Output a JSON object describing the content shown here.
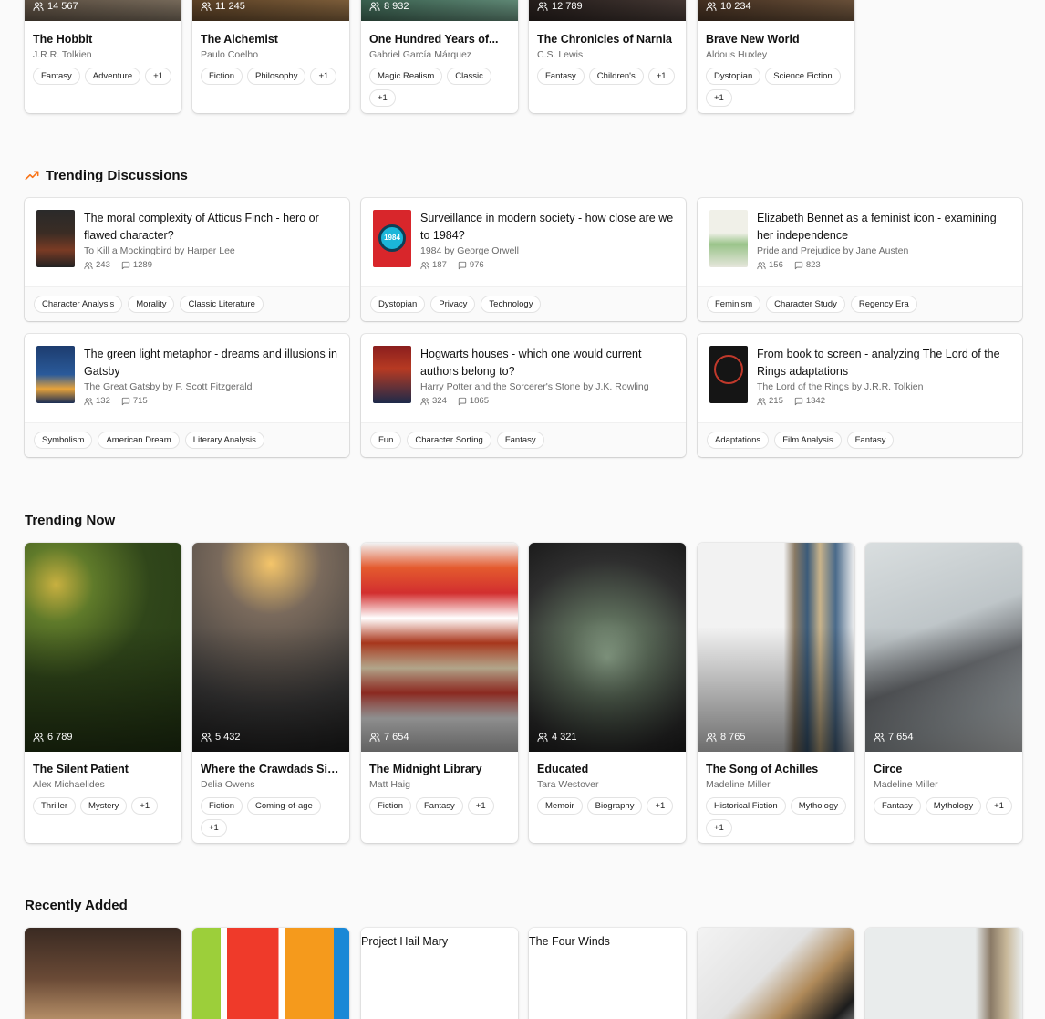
{
  "top_books": [
    {
      "title": "The Hobbit",
      "author": "J.R.R. Tolkien",
      "readers": "14 567",
      "tags": [
        "Fantasy",
        "Adventure",
        "+1"
      ]
    },
    {
      "title": "The Alchemist",
      "author": "Paulo Coelho",
      "readers": "11 245",
      "tags": [
        "Fiction",
        "Philosophy",
        "+1"
      ]
    },
    {
      "title": "One Hundred Years of...",
      "author": "Gabriel García Márquez",
      "readers": "8 932",
      "tags": [
        "Magic Realism",
        "Classic",
        "+1"
      ]
    },
    {
      "title": "The Chronicles of Narnia",
      "author": "C.S. Lewis",
      "readers": "12 789",
      "tags": [
        "Fantasy",
        "Children's",
        "+1"
      ]
    },
    {
      "title": "Brave New World",
      "author": "Aldous Huxley",
      "readers": "10 234",
      "tags": [
        "Dystopian",
        "Science Fiction",
        "+1"
      ]
    }
  ],
  "discussions_heading": "Trending Discussions",
  "discussions": [
    {
      "title": "The moral complexity of Atticus Finch - hero or flawed character?",
      "book": "To Kill a Mockingbird by Harper Lee",
      "members": "243",
      "comments": "1289",
      "tags": [
        "Character Analysis",
        "Morality",
        "Classic Literature"
      ],
      "cover_text": "To Kill a Mockingbird"
    },
    {
      "title": "Surveillance in modern society - how close are we to 1984?",
      "book": "1984 by George Orwell",
      "members": "187",
      "comments": "976",
      "tags": [
        "Dystopian",
        "Privacy",
        "Technology"
      ],
      "cover_text": "1984"
    },
    {
      "title": "Elizabeth Bennet as a feminist icon - examining her independence",
      "book": "Pride and Prejudice by Jane Austen",
      "members": "156",
      "comments": "823",
      "tags": [
        "Feminism",
        "Character Study",
        "Regency Era"
      ],
      "cover_text": ""
    },
    {
      "title": "The green light metaphor - dreams and illusions in Gatsby",
      "book": "The Great Gatsby by F. Scott Fitzgerald",
      "members": "132",
      "comments": "715",
      "tags": [
        "Symbolism",
        "American Dream",
        "Literary Analysis"
      ],
      "cover_text": "The Great Gatsby"
    },
    {
      "title": "Hogwarts houses - which one would current authors belong to?",
      "book": "Harry Potter and the Sorcerer's Stone by J.K. Rowling",
      "members": "324",
      "comments": "1865",
      "tags": [
        "Fun",
        "Character Sorting",
        "Fantasy"
      ],
      "cover_text": "Harry Potter"
    },
    {
      "title": "From book to screen - analyzing The Lord of the Rings adaptations",
      "book": "The Lord of the Rings by J.R.R. Tolkien",
      "members": "215",
      "comments": "1342",
      "tags": [
        "Adaptations",
        "Film Analysis",
        "Fantasy"
      ],
      "cover_text": "The Lord of the Rings"
    }
  ],
  "trending_heading": "Trending Now",
  "trending": [
    {
      "title": "The Silent Patient",
      "author": "Alex Michaelides",
      "readers": "6 789",
      "tags": [
        "Thriller",
        "Mystery",
        "+1"
      ]
    },
    {
      "title": "Where the Crawdads Sing",
      "author": "Delia Owens",
      "readers": "5 432",
      "tags": [
        "Fiction",
        "Coming-of-age",
        "+1"
      ]
    },
    {
      "title": "The Midnight Library",
      "author": "Matt Haig",
      "readers": "7 654",
      "tags": [
        "Fiction",
        "Fantasy",
        "+1"
      ]
    },
    {
      "title": "Educated",
      "author": "Tara Westover",
      "readers": "4 321",
      "tags": [
        "Memoir",
        "Biography",
        "+1"
      ]
    },
    {
      "title": "The Song of Achilles",
      "author": "Madeline Miller",
      "readers": "8 765",
      "tags": [
        "Historical Fiction",
        "Mythology",
        "+1"
      ]
    },
    {
      "title": "Circe",
      "author": "Madeline Miller",
      "readers": "7 654",
      "tags": [
        "Fantasy",
        "Mythology",
        "+1"
      ]
    }
  ],
  "recent_heading": "Recently Added",
  "recent": [
    {
      "alt_title": ""
    },
    {
      "alt_title": ""
    },
    {
      "alt_title": "Project Hail Mary"
    },
    {
      "alt_title": "The Four Winds"
    },
    {
      "alt_title": ""
    },
    {
      "alt_title": ""
    }
  ],
  "colors": {
    "accent": "#f97316",
    "tag_border": "#e3e3e3",
    "muted_text": "#6b6b6b"
  }
}
